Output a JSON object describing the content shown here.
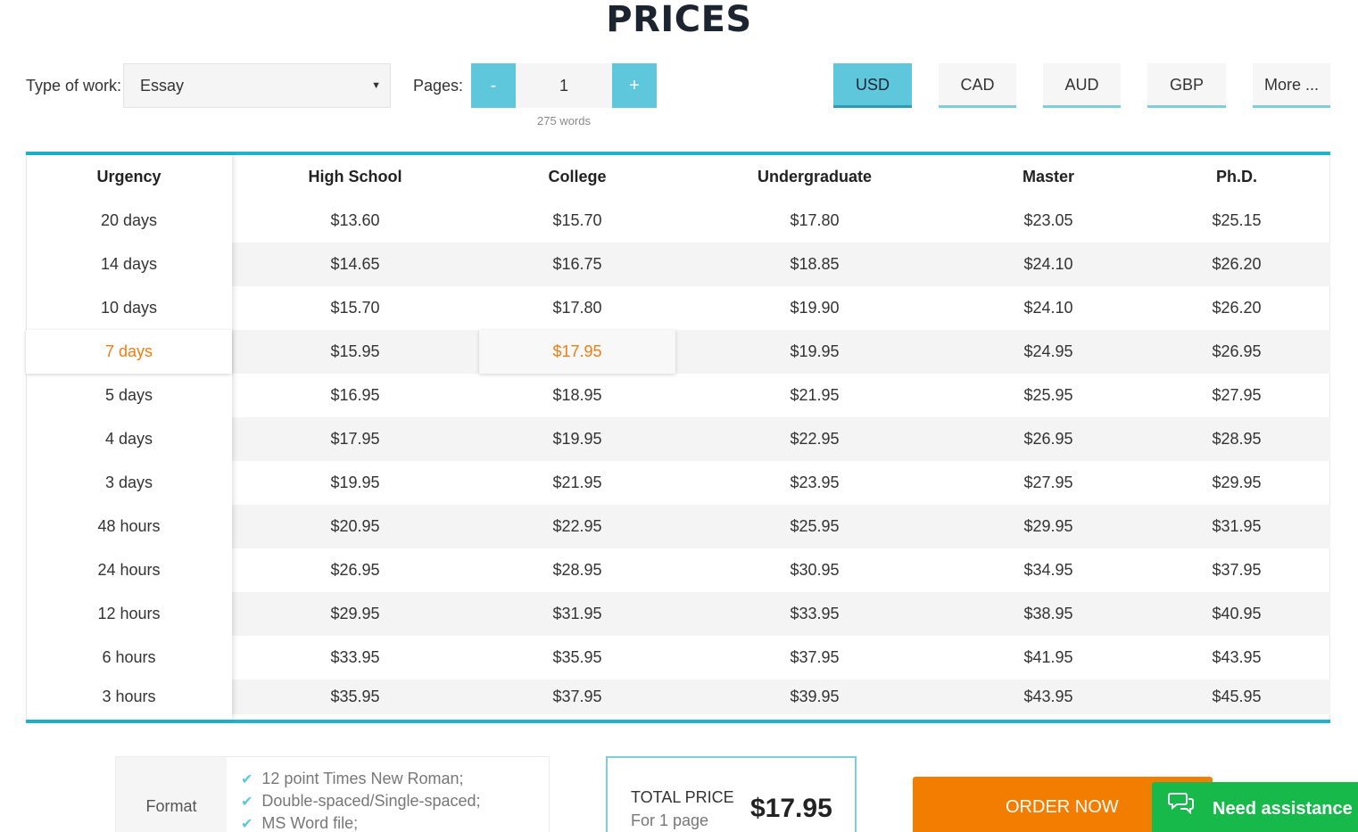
{
  "page": {
    "title": "PRICES"
  },
  "controls": {
    "type_label": "Type of work:",
    "type_value": "Essay",
    "pages_label": "Pages:",
    "minus": "-",
    "plus": "+",
    "pages_value": "1",
    "words": "275 words",
    "currencies": [
      "USD",
      "CAD",
      "AUD",
      "GBP",
      "More ..."
    ],
    "active_currency": "USD"
  },
  "table": {
    "headers": [
      "Urgency",
      "High School",
      "College",
      "Undergraduate",
      "Master",
      "Ph.D."
    ],
    "rows": [
      {
        "urgency": "20 days",
        "prices": [
          "$13.60",
          "$15.70",
          "$17.80",
          "$23.05",
          "$25.15"
        ]
      },
      {
        "urgency": "14 days",
        "prices": [
          "$14.65",
          "$16.75",
          "$18.85",
          "$24.10",
          "$26.20"
        ]
      },
      {
        "urgency": "10 days",
        "prices": [
          "$15.70",
          "$17.80",
          "$19.90",
          "$24.10",
          "$26.20"
        ]
      },
      {
        "urgency": "7 days",
        "prices": [
          "$15.95",
          "$17.95",
          "$19.95",
          "$24.95",
          "$26.95"
        ]
      },
      {
        "urgency": "5 days",
        "prices": [
          "$16.95",
          "$18.95",
          "$21.95",
          "$25.95",
          "$27.95"
        ]
      },
      {
        "urgency": "4 days",
        "prices": [
          "$17.95",
          "$19.95",
          "$22.95",
          "$26.95",
          "$28.95"
        ]
      },
      {
        "urgency": "3 days",
        "prices": [
          "$19.95",
          "$21.95",
          "$23.95",
          "$27.95",
          "$29.95"
        ]
      },
      {
        "urgency": "48 hours",
        "prices": [
          "$20.95",
          "$22.95",
          "$25.95",
          "$29.95",
          "$31.95"
        ]
      },
      {
        "urgency": "24 hours",
        "prices": [
          "$26.95",
          "$28.95",
          "$30.95",
          "$34.95",
          "$37.95"
        ]
      },
      {
        "urgency": "12 hours",
        "prices": [
          "$29.95",
          "$31.95",
          "$33.95",
          "$38.95",
          "$40.95"
        ]
      },
      {
        "urgency": "6 hours",
        "prices": [
          "$33.95",
          "$35.95",
          "$37.95",
          "$41.95",
          "$43.95"
        ]
      },
      {
        "urgency": "3 hours",
        "prices": [
          "$35.95",
          "$37.95",
          "$39.95",
          "$43.95",
          "$45.95"
        ]
      }
    ],
    "selected_row": 3,
    "selected_col": 1
  },
  "format": {
    "label": "Format",
    "features": [
      "12 point Times New Roman;",
      "Double-spaced/Single-spaced;",
      "MS Word file;"
    ]
  },
  "total": {
    "label": "TOTAL PRICE",
    "sub": "For 1 page",
    "value": "$17.95"
  },
  "order_button": "ORDER NOW",
  "assist": {
    "label": "Need assistance",
    "icon": "chat-bubbles-icon"
  },
  "colors": {
    "accent": "#5ec7dc",
    "border": "#1fb3cd",
    "highlight": "#f07c12",
    "order": "#f27d00",
    "assist": "#16b94a"
  }
}
